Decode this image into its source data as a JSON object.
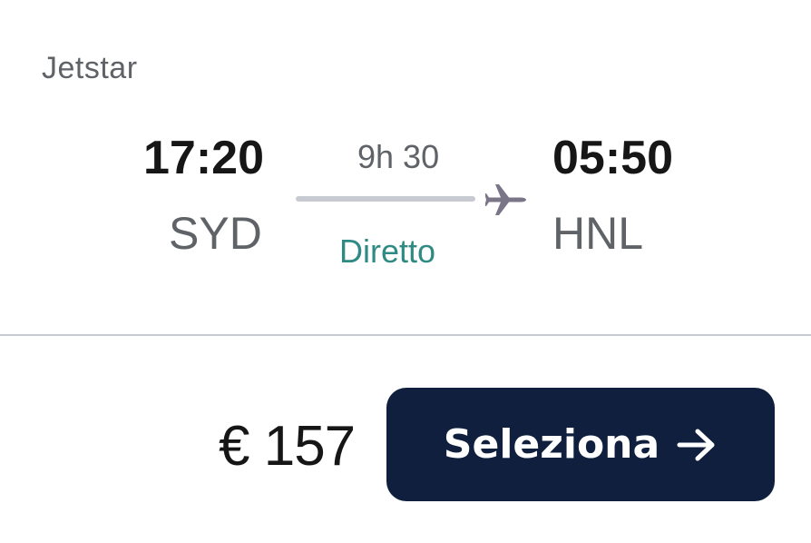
{
  "flight": {
    "airline": "Jetstar",
    "departure_time": "17:20",
    "departure_airport": "SYD",
    "arrival_time": "05:50",
    "arrival_airport": "HNL",
    "duration": "9h 30",
    "stops": "Diretto"
  },
  "booking": {
    "price": "€ 157",
    "select_label": "Seleziona"
  },
  "icons": {
    "plane": "plane-icon",
    "arrow": "arrow-right-icon"
  },
  "colors": {
    "primary_text": "#161616",
    "secondary_text": "#5f6368",
    "stops_text": "#2f8a84",
    "button_background": "#0f1f3d",
    "route_line": "#c7cbd1",
    "plane_icon": "#7b7588"
  }
}
